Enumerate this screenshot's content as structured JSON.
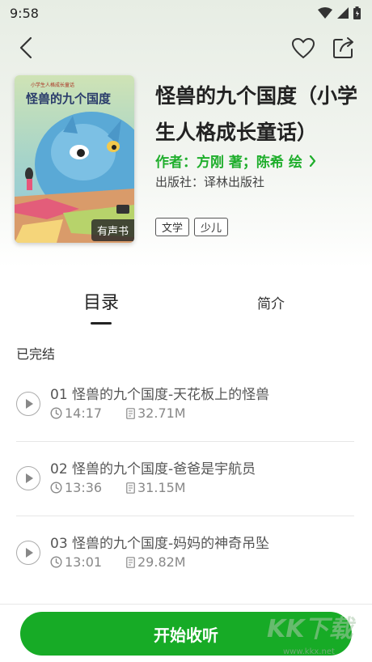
{
  "status_bar": {
    "time": "9:58"
  },
  "book": {
    "title": "怪兽的九个国度（小学生人格成长童话）",
    "author_line": "作者：方刚 著；陈希 绘",
    "publisher": "出版社：译林出版社",
    "tags": [
      "文学",
      "少儿"
    ],
    "cover": {
      "series_label": "小学生人格成长童话",
      "cover_title": "怪兽的九个国度",
      "badge": "有声书"
    }
  },
  "tabs": {
    "toc": "目录",
    "intro": "简介"
  },
  "list_status": "已完结",
  "chapters": [
    {
      "title": "01 怪兽的九个国度-天花板上的怪兽",
      "duration": "14:17",
      "size": "32.71M"
    },
    {
      "title": "02 怪兽的九个国度-爸爸是宇航员",
      "duration": "13:36",
      "size": "31.15M"
    },
    {
      "title": "03 怪兽的九个国度-妈妈的神奇吊坠",
      "duration": "13:01",
      "size": "29.82M"
    }
  ],
  "cta": {
    "label": "开始收听"
  },
  "watermark": {
    "text": "KK下载",
    "url": "www.kkx.net"
  },
  "colors": {
    "accent": "#17ab26",
    "author_green": "#1fae2c",
    "header_bg": "#e7ede4"
  },
  "icons": [
    "back-icon",
    "heart-icon",
    "share-icon",
    "play-icon",
    "clock-icon",
    "file-icon",
    "chevron-right-icon",
    "wifi-icon",
    "signal-icon",
    "battery-icon"
  ]
}
